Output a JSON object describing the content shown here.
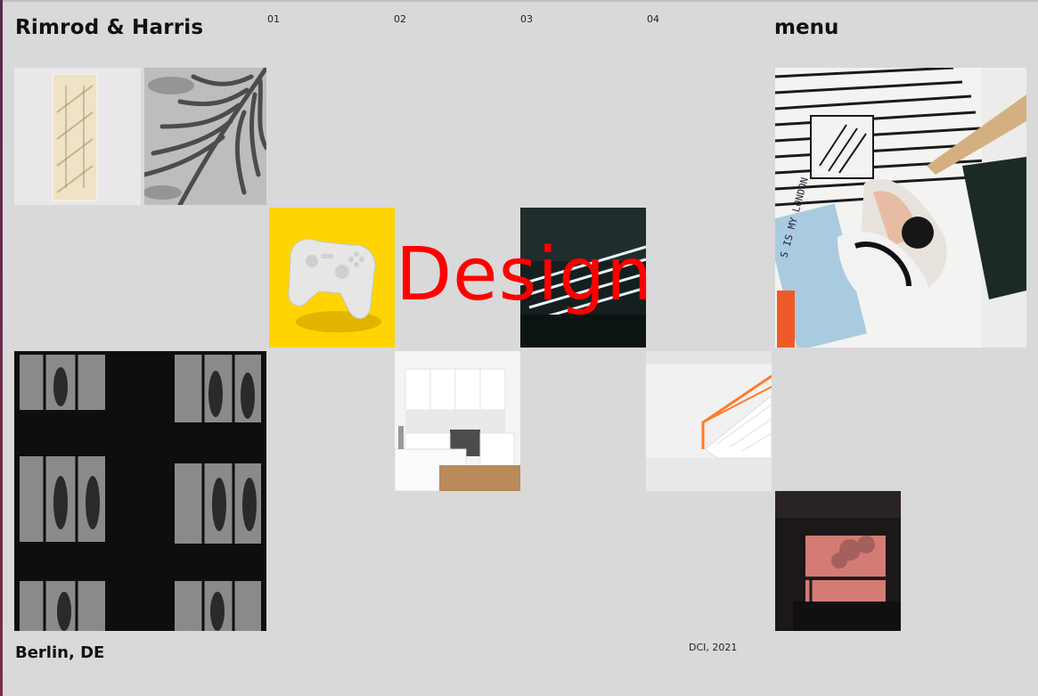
{
  "header": {
    "brand": "Rimrod & Harris",
    "menu_label": "menu",
    "nav": [
      "01",
      "02",
      "03",
      "04"
    ]
  },
  "hero": {
    "word": "Design",
    "color": "#ff0000"
  },
  "footer": {
    "location": "Berlin, DE",
    "credit": "DCI, 2021"
  },
  "colors": {
    "background": "#d9d9d9",
    "accent": "#ff0000"
  },
  "tiles": [
    "staircase-photo",
    "palm-shadow-photo",
    "game-controller-photo",
    "light-stripes-photo",
    "fashion-flatlay-photo",
    "mannequin-windows-photo",
    "kitchen-photo",
    "white-stairs-photo",
    "dark-window-photo"
  ]
}
